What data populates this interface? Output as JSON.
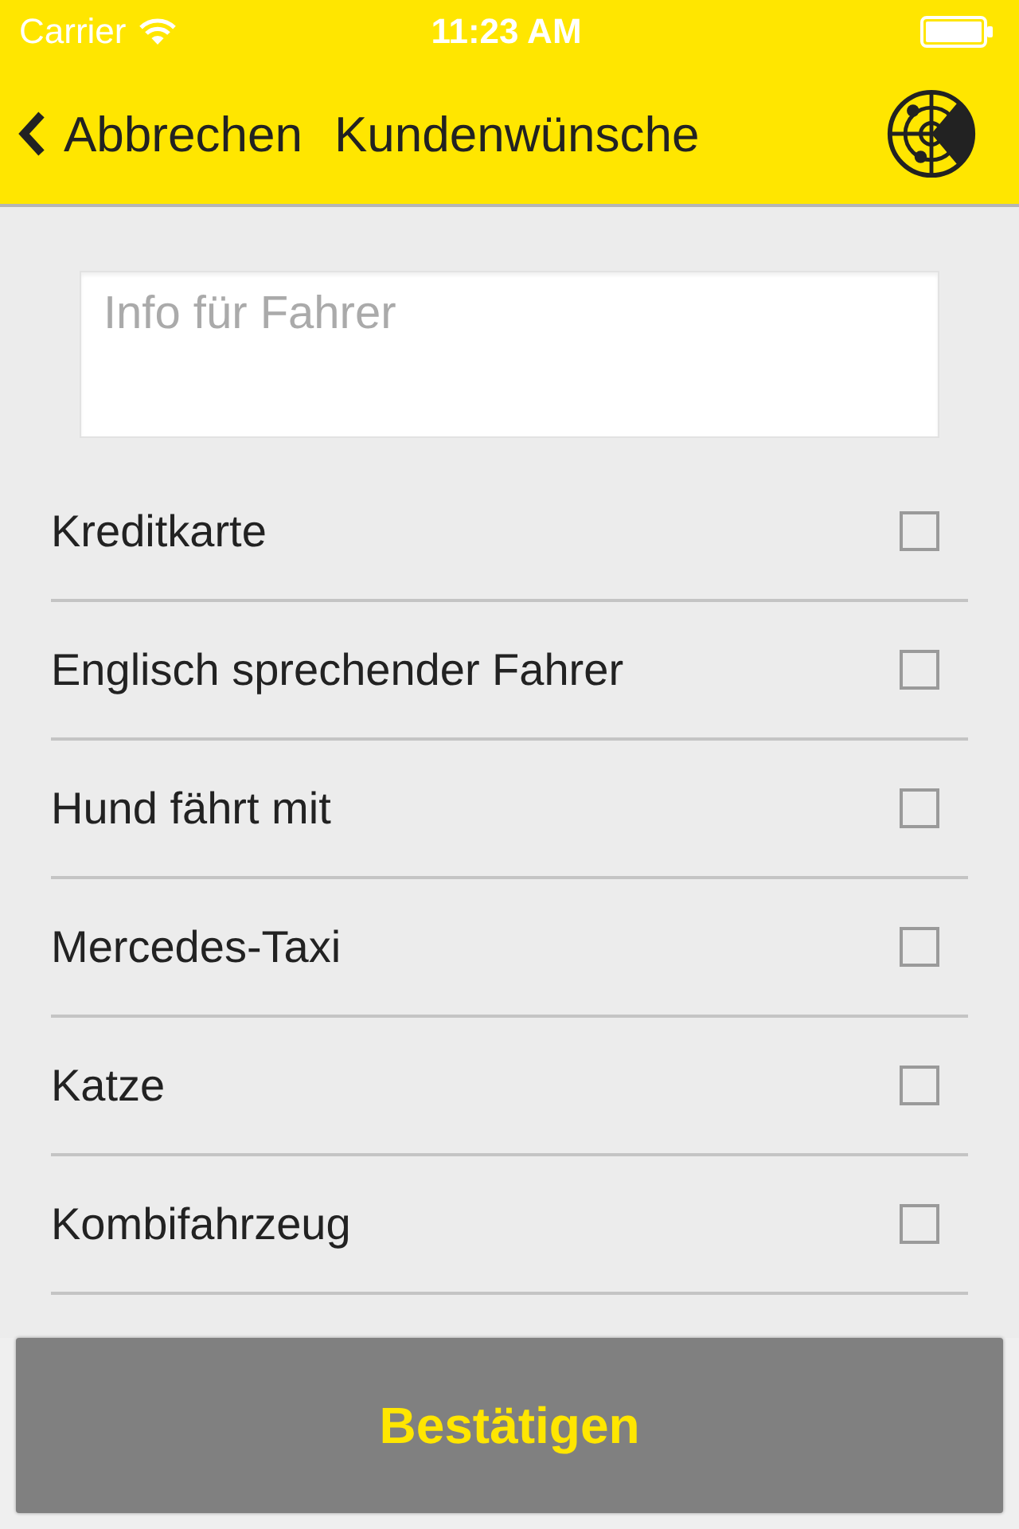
{
  "status_bar": {
    "carrier": "Carrier",
    "time": "11:23 AM"
  },
  "nav_bar": {
    "back_label": "Abbrechen",
    "title": "Kundenwünsche"
  },
  "info_field": {
    "placeholder": "Info für Fahrer"
  },
  "options": [
    {
      "label": "Kreditkarte",
      "checked": false
    },
    {
      "label": "Englisch sprechender Fahrer",
      "checked": false
    },
    {
      "label": "Hund fährt mit",
      "checked": false
    },
    {
      "label": "Mercedes-Taxi",
      "checked": false
    },
    {
      "label": "Katze",
      "checked": false
    },
    {
      "label": "Kombifahrzeug",
      "checked": false
    }
  ],
  "confirm_button": {
    "label": "Bestätigen"
  }
}
